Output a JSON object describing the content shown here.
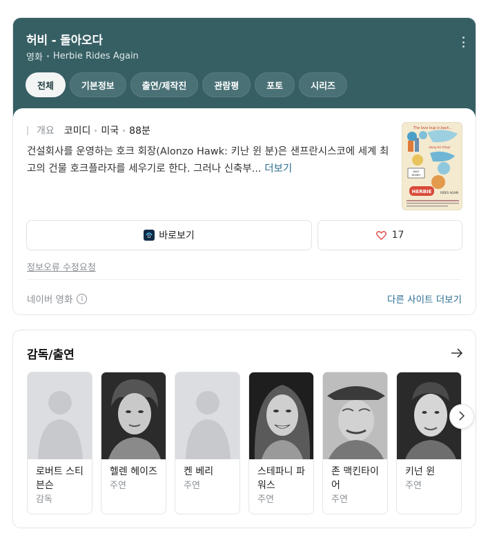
{
  "header": {
    "title": "허비 - 돌아오다",
    "category": "영화",
    "original_title": "Herbie Rides Again"
  },
  "tabs": [
    {
      "label": "전체",
      "active": true
    },
    {
      "label": "기본정보",
      "active": false
    },
    {
      "label": "출연/제작진",
      "active": false
    },
    {
      "label": "관람평",
      "active": false
    },
    {
      "label": "포토",
      "active": false
    },
    {
      "label": "시리즈",
      "active": false
    }
  ],
  "overview": {
    "label": "개요",
    "genre": "코미디",
    "country": "미국",
    "runtime": "88분",
    "description": "건설회사를 운영하는 호크 회장(Alonzo Hawk: 키난 윈 분)은 샌프란시스코에 세계 최고의 건물 호크플라자를 세우기로 한다. 그러나 신축부...",
    "more_label": "더보기"
  },
  "actions": {
    "watch_label": "바로보기",
    "like_count": "17"
  },
  "footer": {
    "report_label": "정보오류 수정요청",
    "source_label": "네이버 영화",
    "other_sites_label": "다른 사이트 더보기"
  },
  "cast": {
    "title": "감독/출연",
    "people": [
      {
        "name": "로버트 스티븐슨",
        "role": "감독",
        "photo": "placeholder"
      },
      {
        "name": "헬렌 헤이즈",
        "role": "주연",
        "photo": "real"
      },
      {
        "name": "켄 베리",
        "role": "주연",
        "photo": "placeholder"
      },
      {
        "name": "스테파니 파워스",
        "role": "주연",
        "photo": "real"
      },
      {
        "name": "존 맥킨타이어",
        "role": "주연",
        "photo": "real"
      },
      {
        "name": "키넌 윈",
        "role": "주연",
        "photo": "real"
      }
    ]
  },
  "colors": {
    "header_bg": "#365f64",
    "link": "#2a6c8e",
    "heart": "#e04a4a"
  },
  "icons": [
    "more-vertical-icon",
    "disney-plus-icon",
    "heart-icon",
    "info-icon",
    "arrow-right-icon",
    "chevron-right-icon",
    "person-placeholder-icon"
  ]
}
